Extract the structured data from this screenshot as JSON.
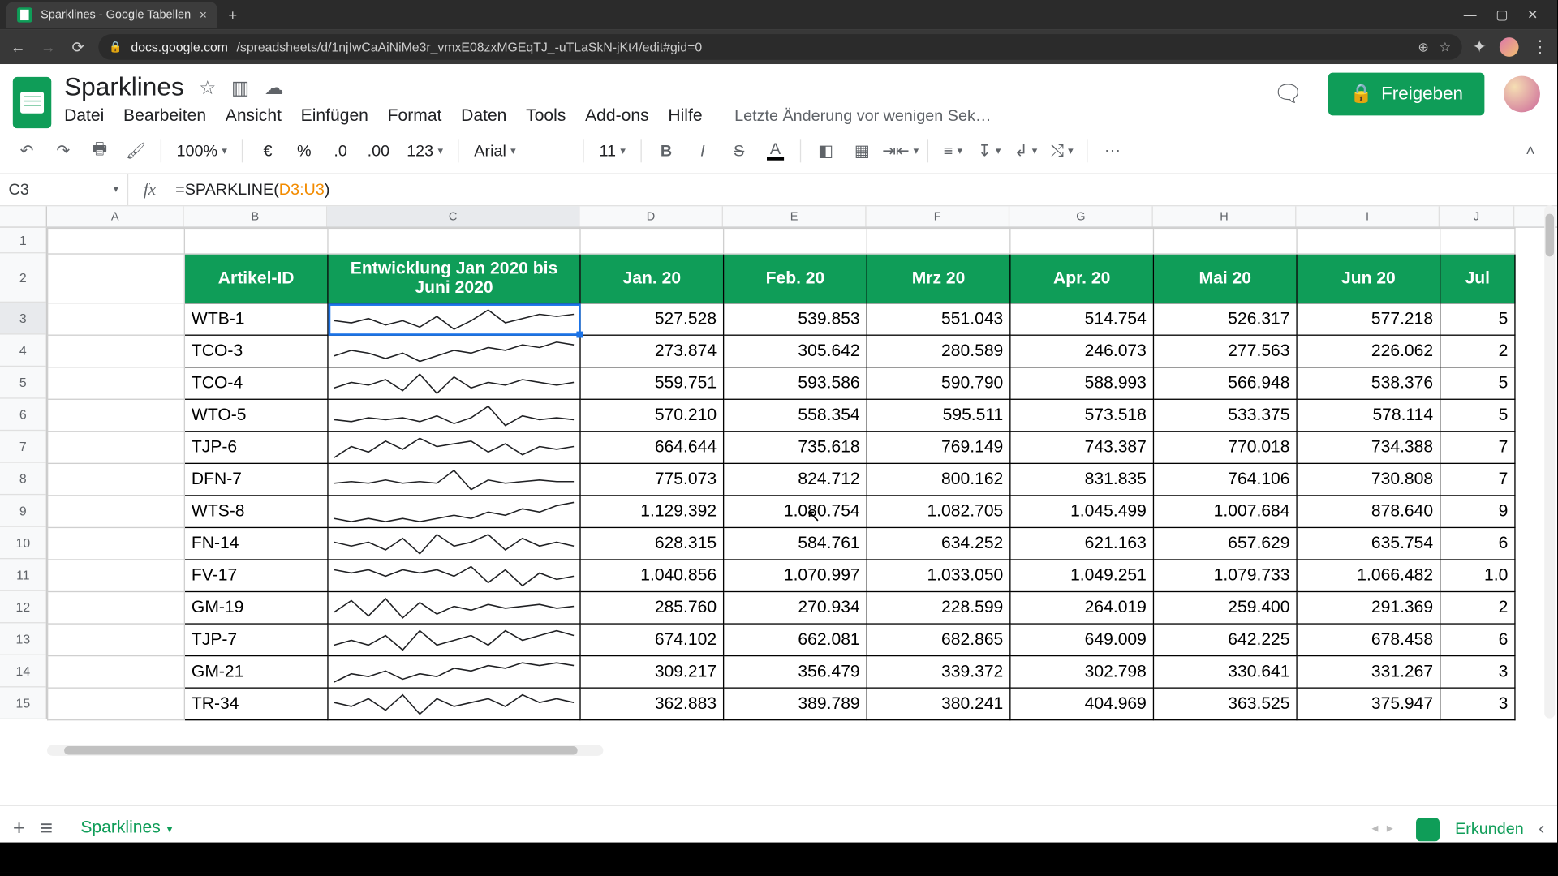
{
  "browser": {
    "tab_title": "Sparklines - Google Tabellen",
    "url_host": "docs.google.com",
    "url_path": "/spreadsheets/d/1njIwCaAiNiMe3r_vmxE08zxMGEqTJ_-uTLaSkN-jKt4/edit#gid=0"
  },
  "sheets": {
    "title": "Sparklines",
    "menus": [
      "Datei",
      "Bearbeiten",
      "Ansicht",
      "Einfügen",
      "Format",
      "Daten",
      "Tools",
      "Add-ons",
      "Hilfe"
    ],
    "last_edit": "Letzte Änderung vor wenigen Sek…",
    "share": "Freigeben",
    "active_cell": "C3",
    "formula_plain": "=SPARKLINE(D3:U3)",
    "formula_ref": "D3:U3",
    "zoom": "100%",
    "font": "Arial",
    "font_size": "11",
    "number_fmt": "123",
    "euro": "€",
    "percent": "%",
    "dec_less": ".0",
    "dec_more": ".00",
    "sheet_tab": "Sparklines",
    "explore": "Erkunden",
    "accent": "#0f9d58"
  },
  "columns": [
    "A",
    "B",
    "C",
    "D",
    "E",
    "F",
    "G",
    "H",
    "I",
    "J"
  ],
  "row_nums": [
    "1",
    "2",
    "3",
    "4",
    "5",
    "6",
    "7",
    "8",
    "9",
    "10",
    "11",
    "12",
    "13",
    "14",
    "15"
  ],
  "headers": {
    "id": "Artikel-ID",
    "dev": "Entwicklung Jan 2020 bis Juni 2020",
    "months": [
      "Jan. 20",
      "Feb. 20",
      "Mrz 20",
      "Apr. 20",
      "Mai 20",
      "Jun 20",
      "Jul"
    ]
  },
  "rows": [
    {
      "id": "WTB-1",
      "v": [
        "527.528",
        "539.853",
        "551.043",
        "514.754",
        "526.317",
        "577.218",
        "5"
      ],
      "sp": [
        13,
        12,
        14,
        11,
        13,
        10,
        15,
        9,
        13,
        18,
        12,
        14,
        16,
        15,
        16
      ]
    },
    {
      "id": "TCO-3",
      "v": [
        "273.874",
        "305.642",
        "280.589",
        "246.073",
        "277.563",
        "226.062",
        "2"
      ],
      "sp": [
        8,
        10,
        9,
        7,
        9,
        6,
        8,
        10,
        9,
        11,
        10,
        12,
        11,
        13,
        12
      ]
    },
    {
      "id": "TCO-4",
      "v": [
        "559.751",
        "593.586",
        "590.790",
        "588.993",
        "566.948",
        "538.376",
        "5"
      ],
      "sp": [
        10,
        12,
        11,
        13,
        9,
        15,
        8,
        14,
        10,
        12,
        11,
        13,
        12,
        11,
        12
      ]
    },
    {
      "id": "WTO-5",
      "v": [
        "570.210",
        "558.354",
        "595.511",
        "573.518",
        "533.375",
        "578.114",
        "5"
      ],
      "sp": [
        11,
        10,
        12,
        11,
        12,
        10,
        13,
        9,
        12,
        18,
        8,
        13,
        11,
        12,
        11
      ]
    },
    {
      "id": "TJP-6",
      "v": [
        "664.644",
        "735.618",
        "769.149",
        "743.387",
        "770.018",
        "734.388",
        "7"
      ],
      "sp": [
        8,
        12,
        10,
        14,
        11,
        15,
        12,
        13,
        14,
        10,
        13,
        9,
        12,
        11,
        12
      ]
    },
    {
      "id": "DFN-7",
      "v": [
        "775.073",
        "824.712",
        "800.162",
        "831.835",
        "764.106",
        "730.808",
        "7"
      ],
      "sp": [
        10,
        11,
        10,
        12,
        10,
        11,
        10,
        18,
        6,
        12,
        10,
        11,
        12,
        11,
        11
      ]
    },
    {
      "id": "WTS-8",
      "v": [
        "1.129.392",
        "1.080.754",
        "1.082.705",
        "1.045.499",
        "1.007.684",
        "878.640",
        "9"
      ],
      "sp": [
        9,
        8,
        9,
        8,
        9,
        8,
        9,
        10,
        9,
        11,
        10,
        12,
        11,
        13,
        14
      ]
    },
    {
      "id": "FN-14",
      "v": [
        "628.315",
        "584.761",
        "634.252",
        "621.163",
        "657.629",
        "635.754",
        "6"
      ],
      "sp": [
        12,
        11,
        12,
        10,
        13,
        9,
        14,
        11,
        12,
        14,
        10,
        13,
        11,
        12,
        11
      ]
    },
    {
      "id": "FV-17",
      "v": [
        "1.040.856",
        "1.070.997",
        "1.033.050",
        "1.049.251",
        "1.079.733",
        "1.066.482",
        "1.0"
      ],
      "sp": [
        14,
        13,
        14,
        12,
        14,
        13,
        14,
        12,
        15,
        10,
        14,
        9,
        13,
        11,
        12
      ]
    },
    {
      "id": "GM-19",
      "v": [
        "285.760",
        "270.934",
        "228.599",
        "264.019",
        "259.400",
        "291.369",
        "2"
      ],
      "sp": [
        9,
        15,
        7,
        16,
        6,
        14,
        8,
        12,
        10,
        13,
        11,
        12,
        13,
        11,
        12
      ]
    },
    {
      "id": "TJP-7",
      "v": [
        "674.102",
        "662.081",
        "682.865",
        "649.009",
        "642.225",
        "678.458",
        "6"
      ],
      "sp": [
        10,
        11,
        10,
        12,
        9,
        13,
        10,
        11,
        12,
        10,
        13,
        11,
        12,
        13,
        12
      ]
    },
    {
      "id": "GM-21",
      "v": [
        "309.217",
        "356.479",
        "339.372",
        "302.798",
        "330.641",
        "331.267",
        "3"
      ],
      "sp": [
        7,
        10,
        9,
        11,
        8,
        10,
        9,
        12,
        11,
        13,
        12,
        14,
        13,
        14,
        13
      ]
    },
    {
      "id": "TR-34",
      "v": [
        "362.883",
        "389.789",
        "380.241",
        "404.969",
        "363.525",
        "375.947",
        "3"
      ],
      "sp": [
        11,
        10,
        12,
        9,
        13,
        8,
        12,
        10,
        11,
        12,
        10,
        13,
        11,
        12,
        11
      ]
    }
  ]
}
